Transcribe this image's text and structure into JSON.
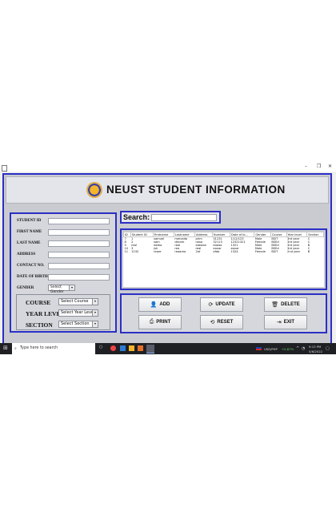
{
  "window": {
    "minimize": "–",
    "maximize": "❐",
    "close": "✕"
  },
  "header": {
    "title": "NEUST STUDENT INFORMATION"
  },
  "form": {
    "student_id_label": "STUDENT ID",
    "first_name_label": "FIRST NAME",
    "last_name_label": "LAST NAME",
    "address_label": "ADDRESS",
    "contact_label": "CONTACT NO.",
    "dob_label": "DATE OF BIRTH",
    "gender_label": "GENDER",
    "gender_value": "Select Gender",
    "course_label": "COURSE",
    "course_value": "Select Course",
    "year_label": "YEAR LEVEL",
    "year_value": "Select Year Level",
    "section_label": "SECTION",
    "section_value": "Select Section"
  },
  "search": {
    "label": "Search:"
  },
  "table": {
    "columns": [
      "ID",
      "Student ID",
      "Firstname",
      "Lastname",
      "Address",
      "Number",
      "Date of bi...",
      "Gender",
      "Course",
      "Year level",
      "Section"
    ],
    "rows": [
      [
        "7",
        "1",
        "samuel",
        "mercado",
        "prim",
        "31231",
        "1/12/123",
        "Male",
        "BSIT",
        "3rd year",
        "C"
      ],
      [
        "8",
        "2",
        "sam",
        "dksnm",
        "nasa",
        "32113",
        "12321321",
        "Female",
        "BSEd",
        "3rd year",
        "C"
      ],
      [
        "9",
        "real",
        "eatea",
        "real",
        "eaeaea",
        "eaeaa",
        "1321",
        "Male",
        "BSEd",
        "3rd year",
        "B"
      ],
      [
        "10",
        "3",
        "jsh",
        "rea",
        "real",
        "eanar",
        "eanar",
        "Male",
        "BSEd",
        "3rd year",
        "C"
      ],
      [
        "11",
        "1232",
        "reare",
        "reaarea",
        "2af",
        "afda",
        "1324",
        "Female",
        "BSIT",
        "2nd year",
        "B"
      ]
    ]
  },
  "buttons": {
    "add": "ADD",
    "update": "UPDATE",
    "delete": "DELETE",
    "print": "PRINT",
    "reset": "RESET",
    "exit": "EXIT"
  },
  "taskbar": {
    "search_placeholder": "Type here to search",
    "currency": "USD/PHP",
    "change": "+0.87%",
    "time": "9:13 PM",
    "date": "5/6/2022"
  },
  "colors": {
    "accent": "#2b2fc4",
    "panel": "#d6d7dc",
    "taskbar": "#1f2024"
  }
}
